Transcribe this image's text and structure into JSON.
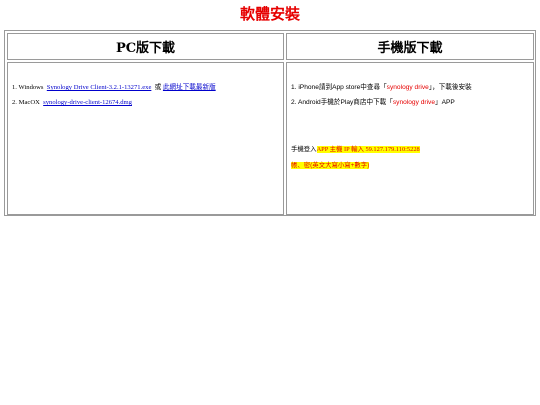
{
  "page": {
    "title": "軟體安裝"
  },
  "pc": {
    "heading": "PC版下載",
    "items": [
      {
        "num": "1.",
        "label": "Windows",
        "link": "Synology Drive Client-3.2.1-13271.exe",
        "sep": "或",
        "link2": "此網址下載最新版"
      },
      {
        "num": "2.",
        "label": "MacOX",
        "link": "synology-drive-client-12674.dmg"
      }
    ]
  },
  "mobile": {
    "heading": "手機版下載",
    "items": [
      {
        "num": "1.",
        "pre": "iPhone請到App store中查尋「",
        "app": "synology drive",
        "post": "」，下載後安裝"
      },
      {
        "num": "2.",
        "pre": "Android手機於Play商店中下載「",
        "app": "synology drive",
        "post": "」APP"
      }
    ],
    "login_prefix": "手機登入",
    "login_highlight": "APP 主機 IP 輸入 59.127.179.110:5228",
    "password_note": "帳、密(英文大寫小寫+數字)"
  },
  "colors": {
    "accent_red": "#e60000",
    "highlight": "#ffff00",
    "link": "#0000cc",
    "border": "#9a9a9a"
  }
}
